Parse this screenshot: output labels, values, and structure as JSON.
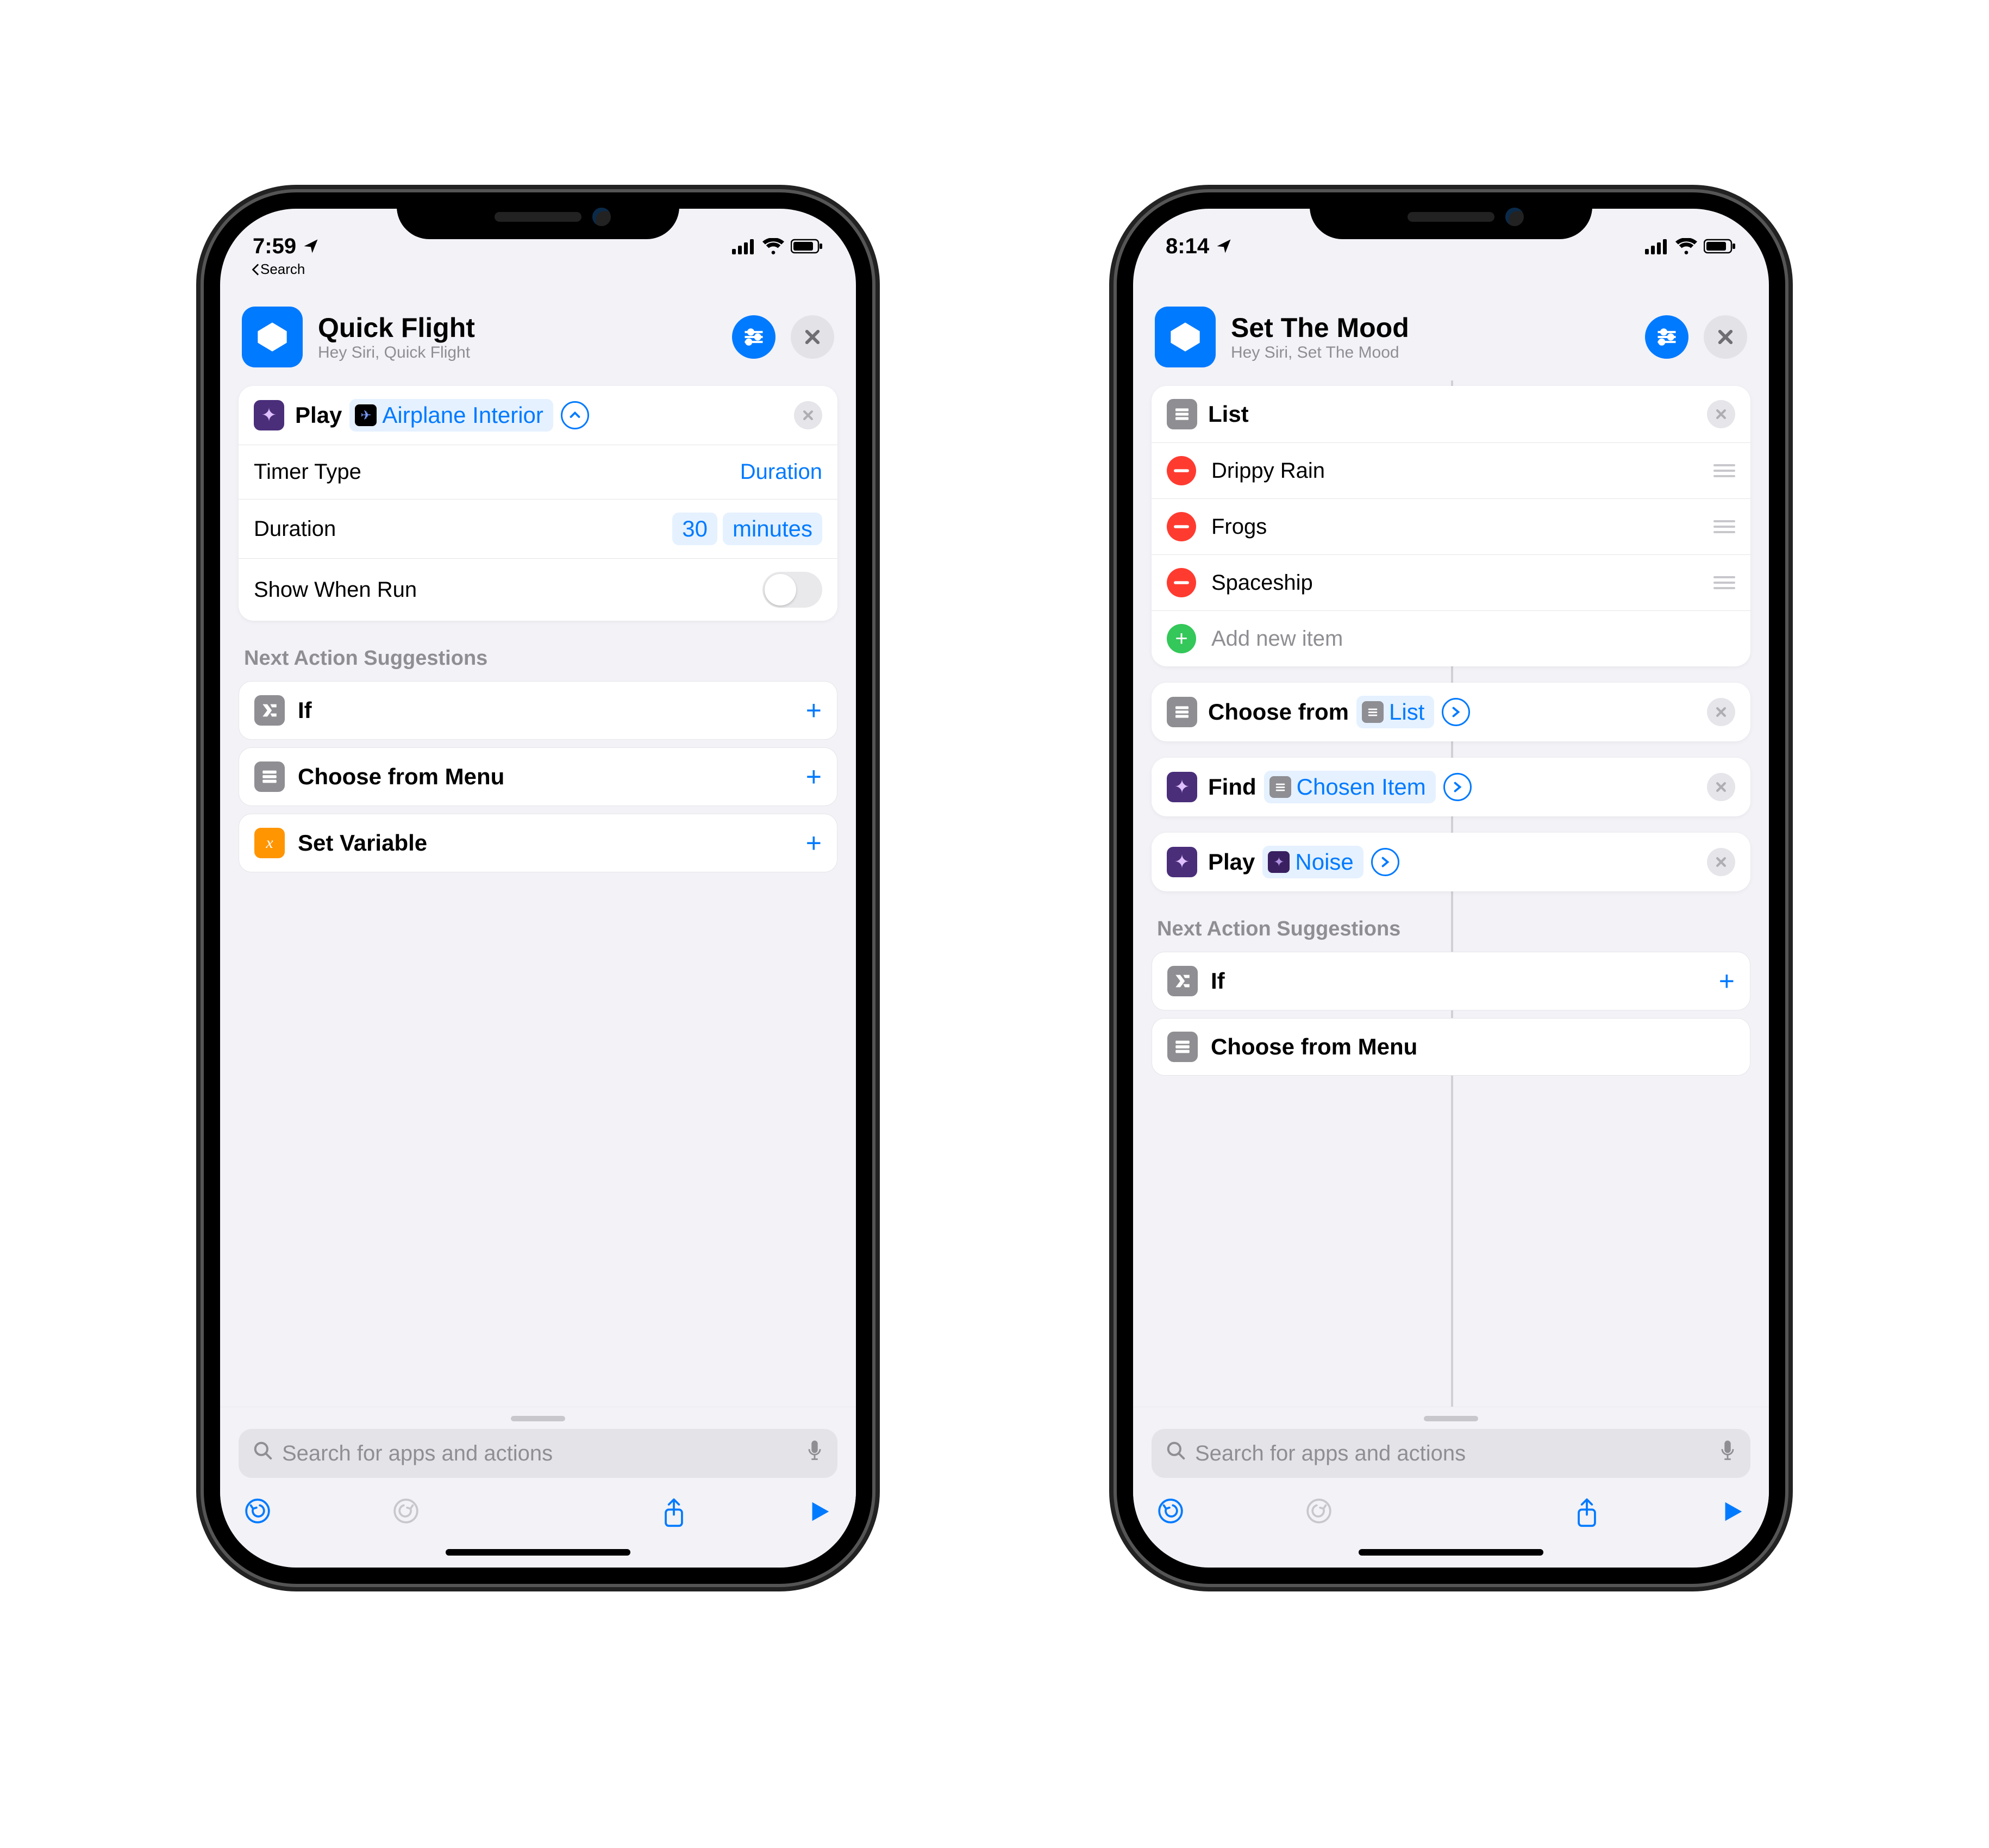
{
  "left": {
    "status": {
      "time": "7:59",
      "back_label": "Search"
    },
    "header": {
      "title": "Quick Flight",
      "subtitle": "Hey Siri, Quick Flight"
    },
    "action": {
      "verb": "Play",
      "sound": "Airplane Interior",
      "rows": {
        "timer_type_label": "Timer Type",
        "timer_type_value": "Duration",
        "duration_label": "Duration",
        "duration_value": "30",
        "duration_unit": "minutes",
        "show_when_run_label": "Show When Run"
      }
    },
    "suggestions": {
      "title": "Next Action Suggestions",
      "items": [
        "If",
        "Choose from Menu",
        "Set Variable"
      ]
    }
  },
  "right": {
    "status": {
      "time": "8:14"
    },
    "header": {
      "title": "Set The Mood",
      "subtitle": "Hey Siri, Set The Mood"
    },
    "list": {
      "title": "List",
      "items": [
        "Drippy Rain",
        "Frogs",
        "Spaceship"
      ],
      "add_placeholder": "Add new item"
    },
    "actions": {
      "choose_verb": "Choose from",
      "choose_var": "List",
      "find_verb": "Find",
      "find_var": "Chosen Item",
      "play_verb": "Play",
      "play_var": "Noise"
    },
    "suggestions": {
      "title": "Next Action Suggestions",
      "items": [
        "If",
        "Choose from Menu"
      ]
    }
  },
  "search": {
    "placeholder": "Search for apps and actions"
  }
}
